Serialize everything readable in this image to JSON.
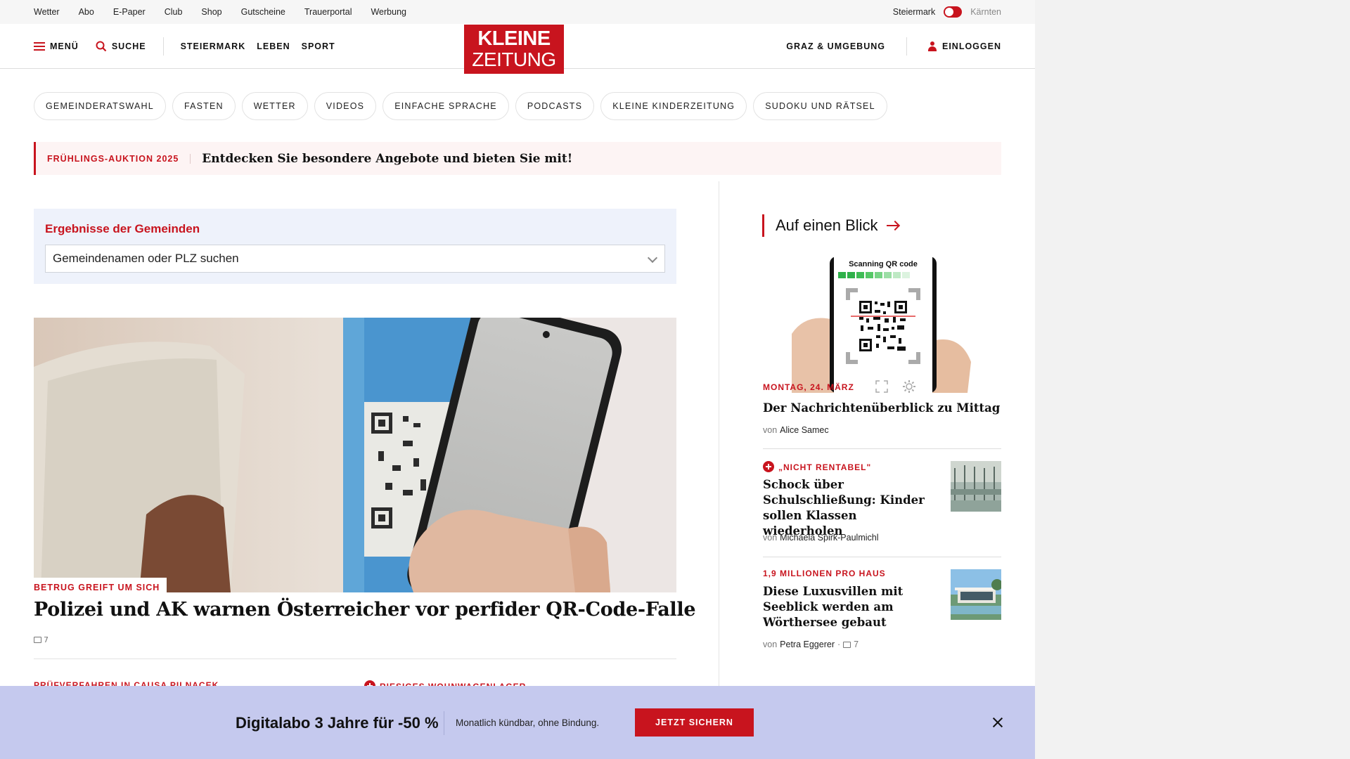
{
  "colors": {
    "brand": "#c8141e",
    "overlay": "#c5c9ee",
    "search_box": "#eef2fb"
  },
  "utility_links": [
    "Wetter",
    "Abo",
    "E-Paper",
    "Club",
    "Shop",
    "Gutscheine",
    "Trauerportal",
    "Werbung"
  ],
  "region": {
    "active": "Steiermark",
    "inactive": "Kärnten"
  },
  "header": {
    "menu_label": "MENÜ",
    "search_label": "SUCHE",
    "nav": [
      "STEIERMARK",
      "LEBEN",
      "SPORT"
    ],
    "logo_line1": "KLEINE",
    "logo_line2": "ZEITUNG",
    "local_label": "GRAZ & UMGEBUNG",
    "login_label": "EINLOGGEN"
  },
  "topics": [
    "GEMEINDERATSWAHL",
    "FASTEN",
    "WETTER",
    "VIDEOS",
    "EINFACHE SPRACHE",
    "PODCASTS",
    "KLEINE KINDERZEITUNG",
    "SUDOKU UND RÄTSEL"
  ],
  "promo": {
    "kicker": "FRÜHLINGS-AUKTION 2025",
    "text": "Entdecken Sie besondere Angebote und bieten Sie mit!"
  },
  "gemeinde": {
    "title": "Ergebnisse der Gemeinden",
    "placeholder": "Gemeindenamen oder PLZ suchen"
  },
  "hero": {
    "kicker": "BETRUG GREIFT UM SICH",
    "title": "Polizei und AK warnen Österreicher vor perfider QR-Code-Falle",
    "comments": "7"
  },
  "lower_kickers": [
    "PRÜFVERFAHREN IN CAUSA PILNACEK",
    "RIESIGES WOHNWAGENLAGER"
  ],
  "sidebar": {
    "heading": "Auf einen Blick",
    "image_text": "Scanning QR code",
    "articles": [
      {
        "kicker": "MONTAG, 24. MÄRZ",
        "title": "Der Nachrichtenüberblick zu Mittag",
        "author": "Alice Samec",
        "comments": ""
      },
      {
        "kicker": "„NICHT RENTABEL\"",
        "title": "Schock über Schulschließung: Kinder sollen Klassen wiederholen",
        "author": "Michaela Spirk-Paulmichl",
        "comments": ""
      },
      {
        "kicker": "1,9 MILLIONEN PRO HAUS",
        "title": "Diese Luxusvillen mit Seeblick werden am Wörthersee gebaut",
        "author": "Petra Eggerer",
        "comments": "7"
      }
    ],
    "by_label": "von"
  },
  "overlay": {
    "title": "Digitalabo 3 Jahre für -50 %",
    "subtitle": "Monatlich kündbar, ohne Bindung.",
    "button": "JETZT SICHERN"
  }
}
